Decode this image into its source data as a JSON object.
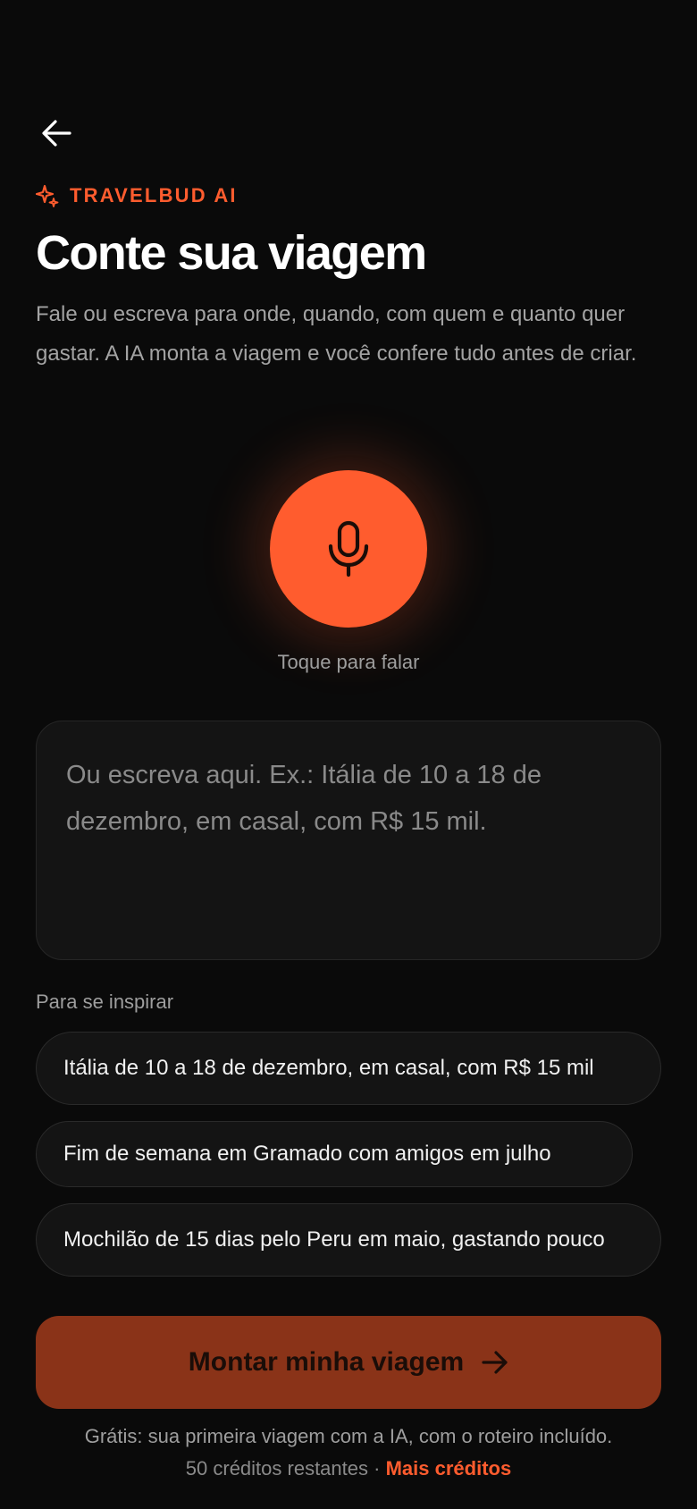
{
  "header": {
    "back_icon": "arrow-left-icon",
    "brand_icon": "sparkle-icon",
    "brand_label": "TRAVELBUD AI",
    "title": "Conte sua viagem",
    "subtitle": "Fale ou escreva para onde, quando, com quem e quanto quer gastar. A IA monta a viagem e você confere tudo antes de criar."
  },
  "voice": {
    "mic_icon": "microphone-icon",
    "label": "Toque para falar"
  },
  "input": {
    "value": "",
    "placeholder": "Ou escreva aqui. Ex.: Itália de 10 a 18 de dezembro, em casal, com R$ 15 mil."
  },
  "inspiration": {
    "label": "Para se inspirar",
    "suggestions": [
      "Itália de 10 a 18 de dezembro, em casal, com R$ 15 mil",
      "Fim de semana em Gramado com amigos em julho",
      "Mochilão de 15 dias pelo Peru em maio, gastando pouco"
    ]
  },
  "cta": {
    "label": "Montar minha viagem",
    "icon": "arrow-right-icon"
  },
  "footer": {
    "free_note": "Grátis: sua primeira viagem com a IA, com o roteiro incluído.",
    "credits_remaining": "50 créditos restantes",
    "separator": "·",
    "more_credits": "Mais créditos"
  },
  "colors": {
    "background": "#0a0a0a",
    "accent": "#ff5c2e",
    "cta_background": "#8a3318",
    "muted_text": "#9e9e9e",
    "surface": "#141414"
  }
}
